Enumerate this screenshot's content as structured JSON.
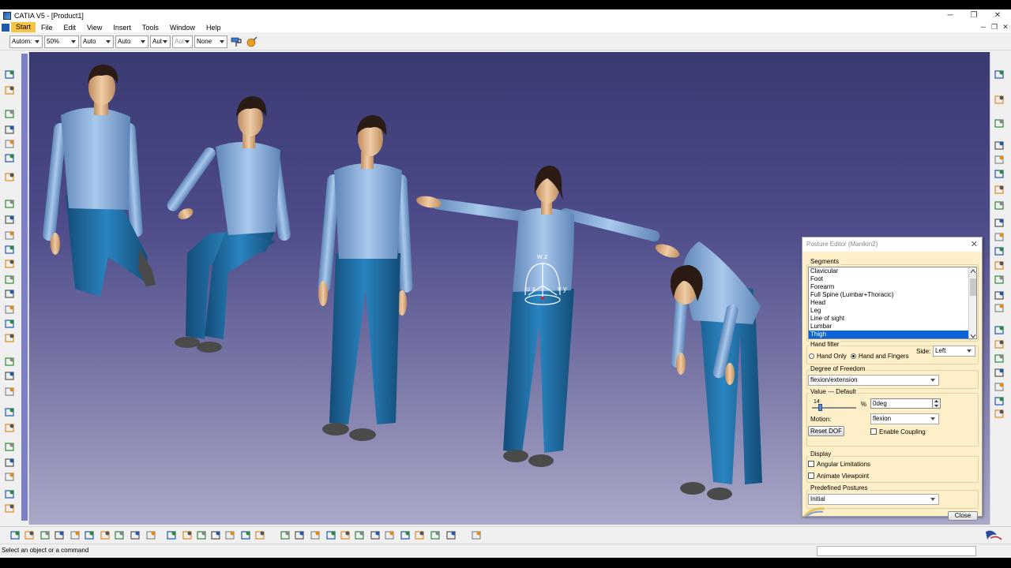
{
  "window": {
    "title": "CATIA V5 - [Product1]",
    "minimize_glyph": "─",
    "maximize_glyph": "❐",
    "close_glyph": "✕"
  },
  "menu": {
    "items": [
      "Start",
      "File",
      "Edit",
      "View",
      "Insert",
      "Tools",
      "Window",
      "Help"
    ]
  },
  "toolbar": {
    "selects": [
      "Autom:",
      "50%",
      "Auto",
      "Auto",
      "Aut",
      "Aut",
      "None"
    ],
    "disabled_index": 5
  },
  "viewport": {
    "background_top": "#3a3a72",
    "background_bottom": "#aaa8c8",
    "compass_labels": {
      "z": "w z",
      "x": "u x",
      "y": "v y"
    },
    "manikin_colors": {
      "shirt": "#8cb2dc",
      "pants": "#1e6aa0",
      "skin": "#e0b890",
      "hair": "#2a1c14",
      "shoes": "#4a4a4a"
    }
  },
  "dialog": {
    "title": "Posture Editor (Manikin2)",
    "segments_label": "Segments",
    "segments": [
      "Clavicular",
      "Foot",
      "Forearm",
      "Full Spine (Lumbar+Thoracic)",
      "Head",
      "Leg",
      "Line of sight",
      "Lumbar",
      "Thigh"
    ],
    "selected_segment": "Thigh",
    "hand_filter_label": "Hand filter",
    "hand_only_label": "Hand Only",
    "hand_fingers_label": "Hand and Fingers",
    "side_label": "Side:",
    "side_value": "Left",
    "dof_label": "Degree of Freedom",
    "dof_value": "flexion/extension",
    "value_label": "Value --- Default",
    "slider_value": "14",
    "slider_fraction": 0.14,
    "percent_label": "%",
    "value_input": "0deg",
    "motion_label": "Motion:",
    "motion_value": "flexion",
    "reset_label": "Reset DOF",
    "coupling_label": "Enable Coupling",
    "display_label": "Display",
    "angular_label": "Angular Limitations",
    "animate_label": "Animate Viewpoint",
    "predefined_label": "Predefined Postures",
    "predefined_value": "Initial",
    "close_label": "Close"
  },
  "status": {
    "message": "Select an object or a command"
  },
  "icons": {
    "accent": "#1e5aa8",
    "orange": "#e08a1e",
    "green": "#2e8a3a"
  }
}
